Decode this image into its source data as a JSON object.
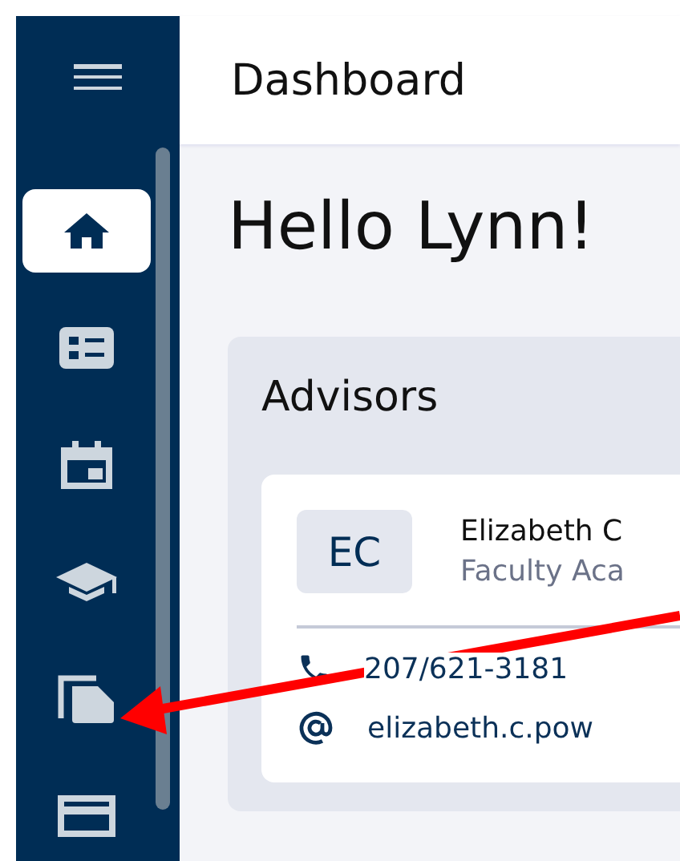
{
  "sidebar": {
    "items": [
      {
        "kind": "home",
        "selected": true
      },
      {
        "kind": "list",
        "selected": false
      },
      {
        "kind": "calendar",
        "selected": false
      },
      {
        "kind": "school",
        "selected": false
      },
      {
        "kind": "documents",
        "selected": false
      },
      {
        "kind": "card",
        "selected": false
      }
    ]
  },
  "header": {
    "title": "Dashboard"
  },
  "greeting": "Hello Lynn!",
  "advisors": {
    "title": "Advisors",
    "cards": [
      {
        "initials": "EC",
        "name": "Elizabeth C",
        "role": "Faculty Aca",
        "phone": "207/621-3181",
        "email": "elizabeth.c.pow"
      }
    ]
  }
}
